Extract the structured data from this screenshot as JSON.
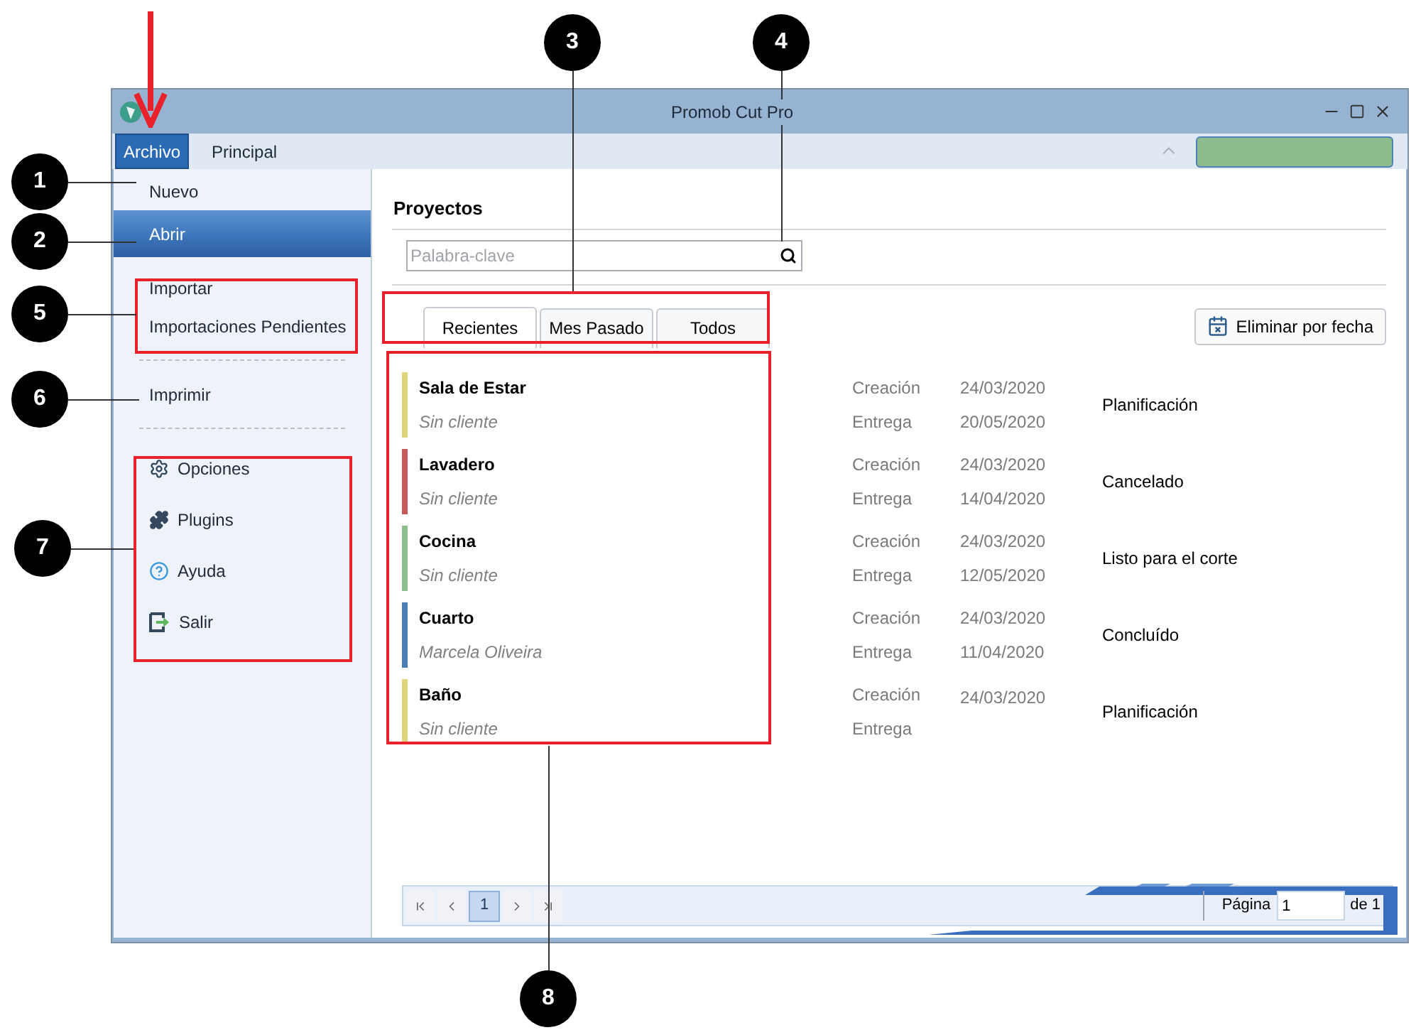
{
  "window": {
    "title": "Promob Cut Pro"
  },
  "menu_tabs": [
    {
      "label": "Archivo",
      "selected": true
    },
    {
      "label": "Principal",
      "selected": false
    }
  ],
  "sidebar": {
    "items": [
      {
        "kind": "item",
        "label": "Nuevo",
        "selected": false
      },
      {
        "kind": "item",
        "label": "Abrir",
        "selected": true
      },
      {
        "kind": "separator_gap"
      },
      {
        "kind": "item",
        "label": "Importar",
        "selected": false
      },
      {
        "kind": "item",
        "label": "Importaciones Pendientes",
        "selected": false
      },
      {
        "kind": "separator"
      },
      {
        "kind": "item",
        "label": "Imprimir",
        "selected": false
      },
      {
        "kind": "separator"
      },
      {
        "kind": "icon_item",
        "label": "Opciones",
        "selected": false
      },
      {
        "kind": "icon_item",
        "label": "Plugins",
        "selected": false
      },
      {
        "kind": "icon_item",
        "label": "Ayuda",
        "selected": false
      },
      {
        "kind": "icon_item",
        "label": "Salir",
        "selected": false
      }
    ]
  },
  "projects": {
    "heading": "Proyectos",
    "search": {
      "placeholder": "Palabra-clave"
    },
    "tabs": [
      {
        "label": "Recientes",
        "selected": true
      },
      {
        "label": "Mes Pasado",
        "selected": false
      },
      {
        "label": "Todos",
        "selected": false
      }
    ],
    "delete_button": "Eliminar por fecha",
    "rows": [
      {
        "color": "#e0d47a",
        "name": "Sala de Estar",
        "client": "Sin cliente",
        "created_label": "Creación",
        "created": "24/03/2020",
        "delivery_label": "Entrega",
        "delivery": "20/05/2020",
        "status": "Planificación"
      },
      {
        "color": "#c85a5a",
        "name": "Lavadero",
        "client": "Sin cliente",
        "created_label": "Creación",
        "created": "24/03/2020",
        "delivery_label": "Entrega",
        "delivery": "14/04/2020",
        "status": "Cancelado"
      },
      {
        "color": "#8bbf8b",
        "name": "Cocina",
        "client": "Sin cliente",
        "created_label": "Creación",
        "created": "24/03/2020",
        "delivery_label": "Entrega",
        "delivery": "12/05/2020",
        "status": "Listo para el corte"
      },
      {
        "color": "#4a7fb5",
        "name": "Cuarto",
        "client": "Marcela Oliveira",
        "created_label": "Creación",
        "created": "24/03/2020",
        "delivery_label": "Entrega",
        "delivery": "11/04/2020",
        "status": "Concluído"
      },
      {
        "color": "#e0d47a",
        "name": "Baño",
        "client": "Sin cliente",
        "created_label": "Creación",
        "created": "24/03/2020",
        "delivery_label": "Entrega",
        "status": "Planificación"
      }
    ],
    "pager": {
      "pages": [
        {
          "label": "1",
          "selected": true
        }
      ],
      "page_label": "Página",
      "page_value": "1",
      "of_label": "de 1"
    }
  },
  "annotations": {
    "callouts": [
      "1",
      "2",
      "3",
      "4",
      "5",
      "6",
      "7",
      "8"
    ]
  }
}
